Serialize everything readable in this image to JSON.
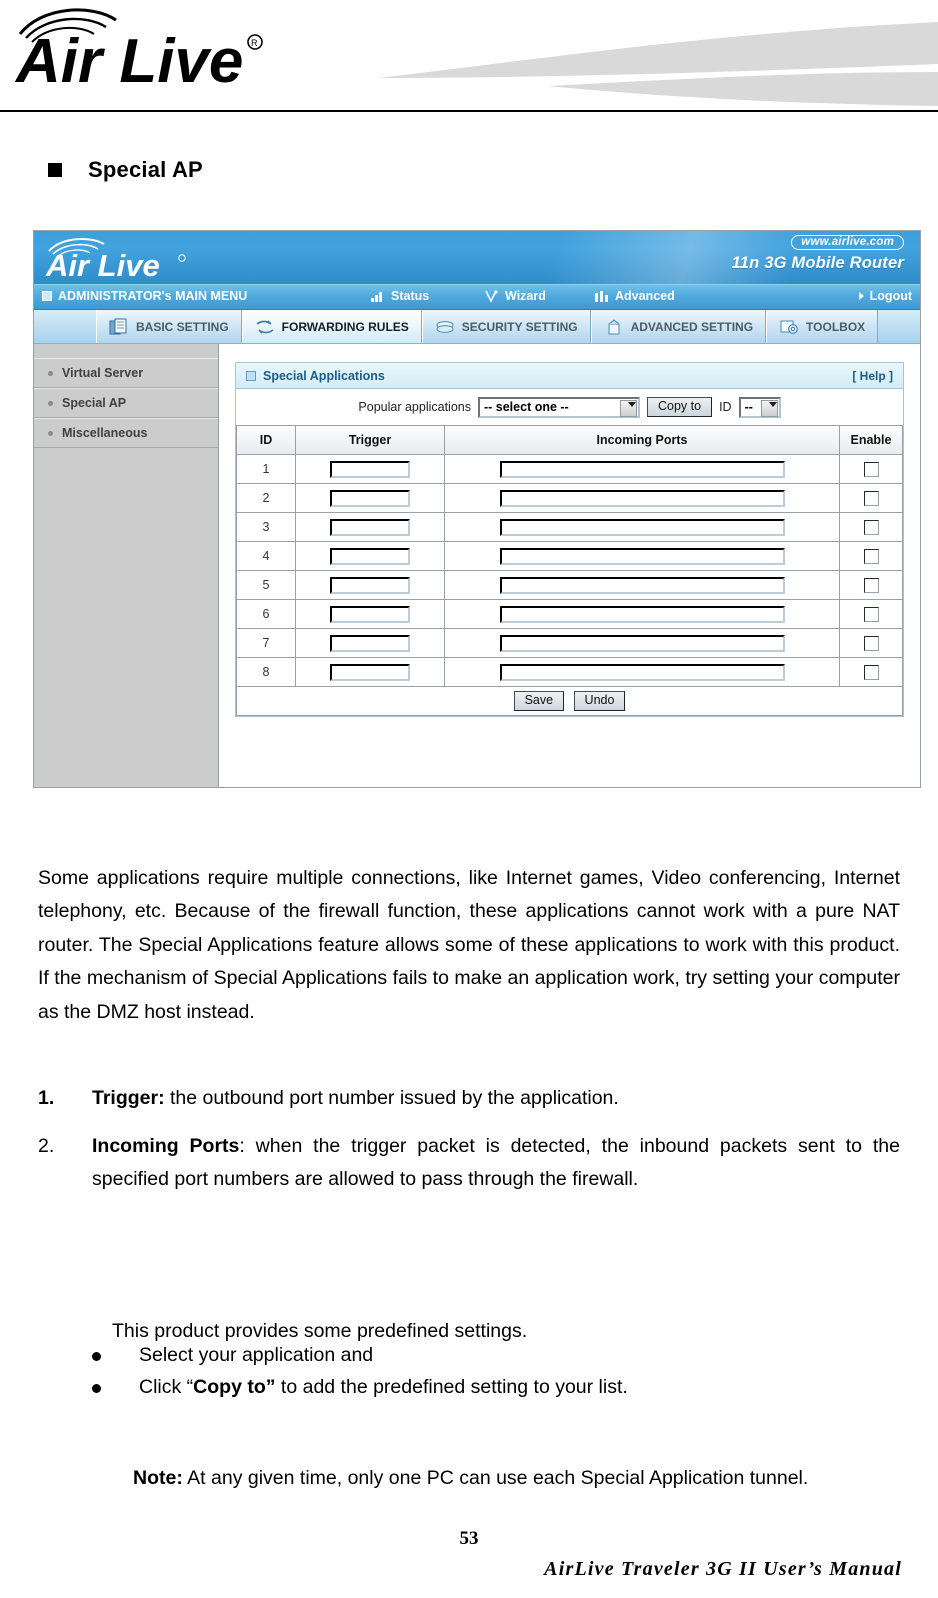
{
  "brand": {
    "logo_text": "AirLive",
    "registered_mark": "®"
  },
  "section": {
    "heading": "Special AP"
  },
  "router_ui": {
    "brandbar": {
      "logo_text": "Air Live",
      "url_badge": "www.airlive.com",
      "model": "11n 3G Mobile Router"
    },
    "menubar": {
      "main_menu": "ADMINISTRATOR's MAIN MENU",
      "status": "Status",
      "wizard": "Wizard",
      "advanced": "Advanced",
      "logout": "Logout"
    },
    "tabs": [
      {
        "label": "BASIC SETTING",
        "icon": "documents-icon",
        "active": false
      },
      {
        "label": "FORWARDING RULES",
        "icon": "arrows-icon",
        "active": true
      },
      {
        "label": "SECURITY SETTING",
        "icon": "shield-icon",
        "active": false
      },
      {
        "label": "ADVANCED SETTING",
        "icon": "tower-icon",
        "active": false
      },
      {
        "label": "TOOLBOX",
        "icon": "gear-icon",
        "active": false
      }
    ],
    "sidebar": {
      "items": [
        {
          "label": "Virtual Server"
        },
        {
          "label": "Special AP"
        },
        {
          "label": "Miscellaneous"
        }
      ]
    },
    "panel": {
      "title": "Special Applications",
      "help_label": "[ Help ]",
      "popular": {
        "label": "Popular applications",
        "selected": "-- select one --",
        "copy_button": "Copy to",
        "id_label": "ID",
        "id_selected": "--"
      },
      "table": {
        "headers": [
          "ID",
          "Trigger",
          "Incoming Ports",
          "Enable"
        ],
        "rows": [
          {
            "id": "1",
            "trigger": "",
            "ports": "",
            "enabled": false
          },
          {
            "id": "2",
            "trigger": "",
            "ports": "",
            "enabled": false
          },
          {
            "id": "3",
            "trigger": "",
            "ports": "",
            "enabled": false
          },
          {
            "id": "4",
            "trigger": "",
            "ports": "",
            "enabled": false
          },
          {
            "id": "5",
            "trigger": "",
            "ports": "",
            "enabled": false
          },
          {
            "id": "6",
            "trigger": "",
            "ports": "",
            "enabled": false
          },
          {
            "id": "7",
            "trigger": "",
            "ports": "",
            "enabled": false
          },
          {
            "id": "8",
            "trigger": "",
            "ports": "",
            "enabled": false
          }
        ]
      },
      "actions": {
        "save": "Save",
        "undo": "Undo"
      }
    }
  },
  "prose": {
    "intro": "Some applications require multiple connections, like Internet games, Video conferencing, Internet telephony, etc. Because of the firewall function, these applications cannot work with a pure NAT router. The Special Applications feature allows some of these applications to work with this product. If the mechanism of Special Applications fails to make an application work, try setting your computer as the DMZ host instead.",
    "items": [
      {
        "number": "1.",
        "term": "Trigger:",
        "text": " the outbound port number issued by the application."
      },
      {
        "number": "2.",
        "term": "Incoming Ports",
        "text": ": when the trigger packet is detected, the inbound packets sent to the specified port numbers are allowed to pass through the firewall."
      }
    ],
    "predefined": "This product provides some predefined settings.",
    "bullets": [
      {
        "pre": "Select your application and",
        "bold": "",
        "post": ""
      },
      {
        "pre": "Click “",
        "bold": "Copy to”",
        "post": " to add the predefined setting to your list."
      }
    ],
    "note_label": "Note:",
    "note_text": " At any given time, only one PC can use each Special Application tunnel."
  },
  "footer": {
    "page_number": "53",
    "manual": "AirLive  Traveler  3G  II  User’s  Manual"
  },
  "colors": {
    "brand_blue": "#3f9fdb",
    "panel_blue": "#1b5d88",
    "sidebar_gray": "#cccccc",
    "swoosh_gray": "#d9d9d9"
  }
}
